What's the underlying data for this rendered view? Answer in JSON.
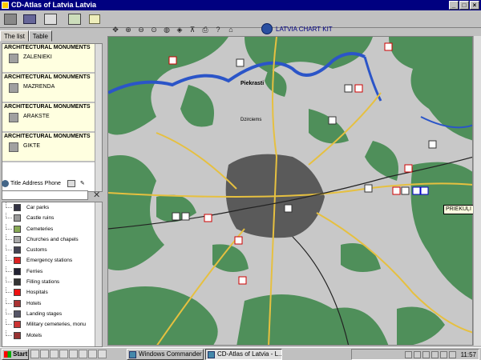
{
  "window": {
    "title": "CD-Atlas of Latvia   Latvia",
    "btn_min": "_",
    "btn_max": "□",
    "btn_close": "×"
  },
  "toolbar": {
    "chart_kit_label": "LATVIA CHART KIT"
  },
  "left": {
    "tabs": [
      {
        "label": "The list"
      },
      {
        "label": "Table"
      }
    ],
    "monuments": [
      {
        "header": "ARCHITECTURAL MONUMENTS",
        "name": "ZALENIEKI"
      },
      {
        "header": "ARCHITECTURAL MONUMENTS",
        "name": "MAZRENDA"
      },
      {
        "header": "ARCHITECTURAL MONUMENTS",
        "name": "ARAKSTE"
      },
      {
        "header": "ARCHITECTURAL MONUMENTS",
        "name": "GIKTE"
      }
    ],
    "columns": {
      "title": "Title",
      "address": "Address",
      "phone": "Phone"
    },
    "legend": [
      {
        "label": "Car parks",
        "color": "#334"
      },
      {
        "label": "Castle ruins",
        "color": "#999"
      },
      {
        "label": "Cemeteries",
        "color": "#8a5"
      },
      {
        "label": "Churches and chapels",
        "color": "#aaa"
      },
      {
        "label": "Customs",
        "color": "#445"
      },
      {
        "label": "Emergency stations",
        "color": "#d22"
      },
      {
        "label": "Ferries",
        "color": "#223"
      },
      {
        "label": "Filling stations",
        "color": "#333"
      },
      {
        "label": "Hospitals",
        "color": "#e11"
      },
      {
        "label": "Hotels",
        "color": "#a33"
      },
      {
        "label": "Landing stages",
        "color": "#556"
      },
      {
        "label": "Military cemeteries, monu",
        "color": "#c33"
      },
      {
        "label": "Motels",
        "color": "#933"
      }
    ]
  },
  "map": {
    "labels": {
      "piekrasti": "Piekrasti",
      "dzirciems": "Dzirciems",
      "tooltip": "PRIEKUĻI PAG"
    }
  },
  "taskbar": {
    "start_label": "Start",
    "tasks": [
      {
        "label": "Windows Commander 4.03 ..."
      },
      {
        "label": "CD-Atlas of Latvia - L..."
      }
    ],
    "clock": "11:57"
  }
}
